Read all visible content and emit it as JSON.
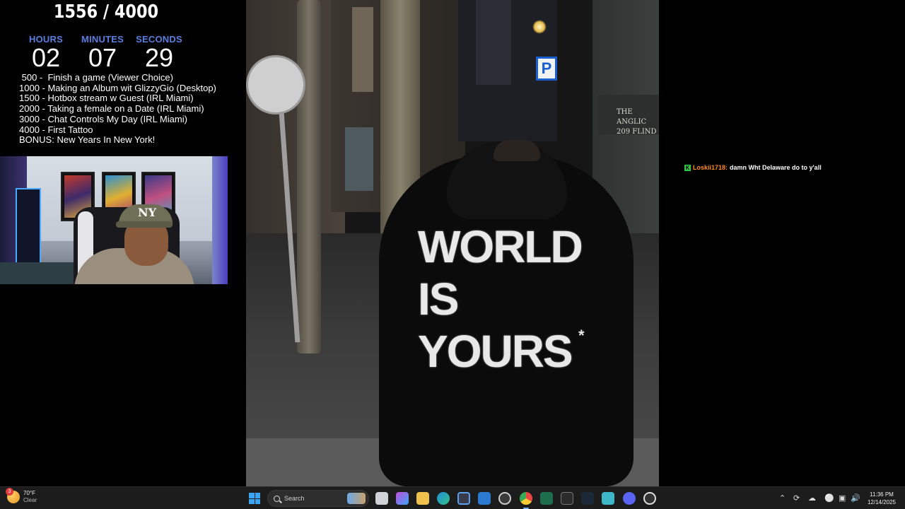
{
  "overlay": {
    "goal_counter": "1556 / 4000",
    "timer": [
      {
        "label": "HOURS",
        "value": "02"
      },
      {
        "label": "MINUTES",
        "value": "07"
      },
      {
        "label": "SECONDS",
        "value": "29"
      }
    ],
    "goals": [
      " 500 -  Finish a game (Viewer Choice)",
      "1000 - Making an Album wit GlizzyGio (Desktop)",
      "1500 - Hotbox stream w Guest (IRL Miami)",
      "2000 - Taking a female on a Date (IRL Miami)",
      "3000 - Chat Controls My Day (IRL Miami)",
      "4000 - First Tattoo",
      "BONUS: New Years In New York!"
    ]
  },
  "webcam": {
    "cap_logo": "NY"
  },
  "photo": {
    "hoodie_print": "WORLD\nIS\nYOURS",
    "hoodie_asterisk": "*",
    "parking_sign": "P",
    "plaque": [
      "THE ANGLIC",
      "209 FLIND"
    ]
  },
  "chat": {
    "messages": [
      {
        "badge": "K",
        "user": "Loskii1718:",
        "text": "damn Wht Delaware do to y'all"
      }
    ]
  },
  "taskbar": {
    "weather": {
      "badge": "3",
      "temp": "70°F",
      "condition": "Clear"
    },
    "search_label": "Search",
    "clock": {
      "time": "11:36 PM",
      "date": "12/14/2025"
    },
    "icon_colors": {
      "accent": "#3aa4f5",
      "chat_user": "#ff8a1d",
      "timer_label": "#5b7fe0"
    }
  }
}
